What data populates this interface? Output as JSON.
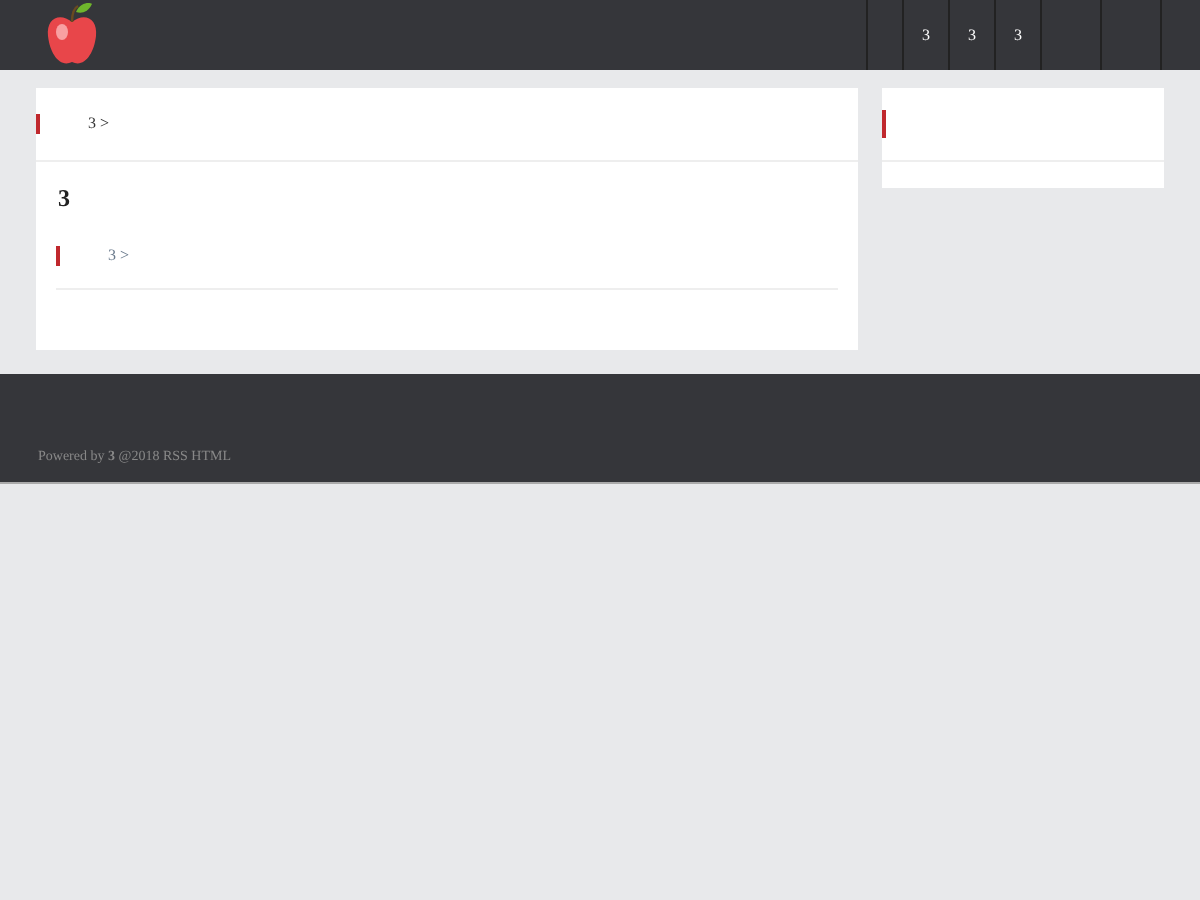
{
  "nav": [
    {
      "label": "3"
    },
    {
      "label": "3"
    },
    {
      "label": "3"
    }
  ],
  "main": {
    "breadcrumb": "3 >",
    "heading": "3",
    "sub_breadcrumb": "3 >"
  },
  "footer": {
    "text": "Powered by **3** @2018 RSS HTML"
  }
}
